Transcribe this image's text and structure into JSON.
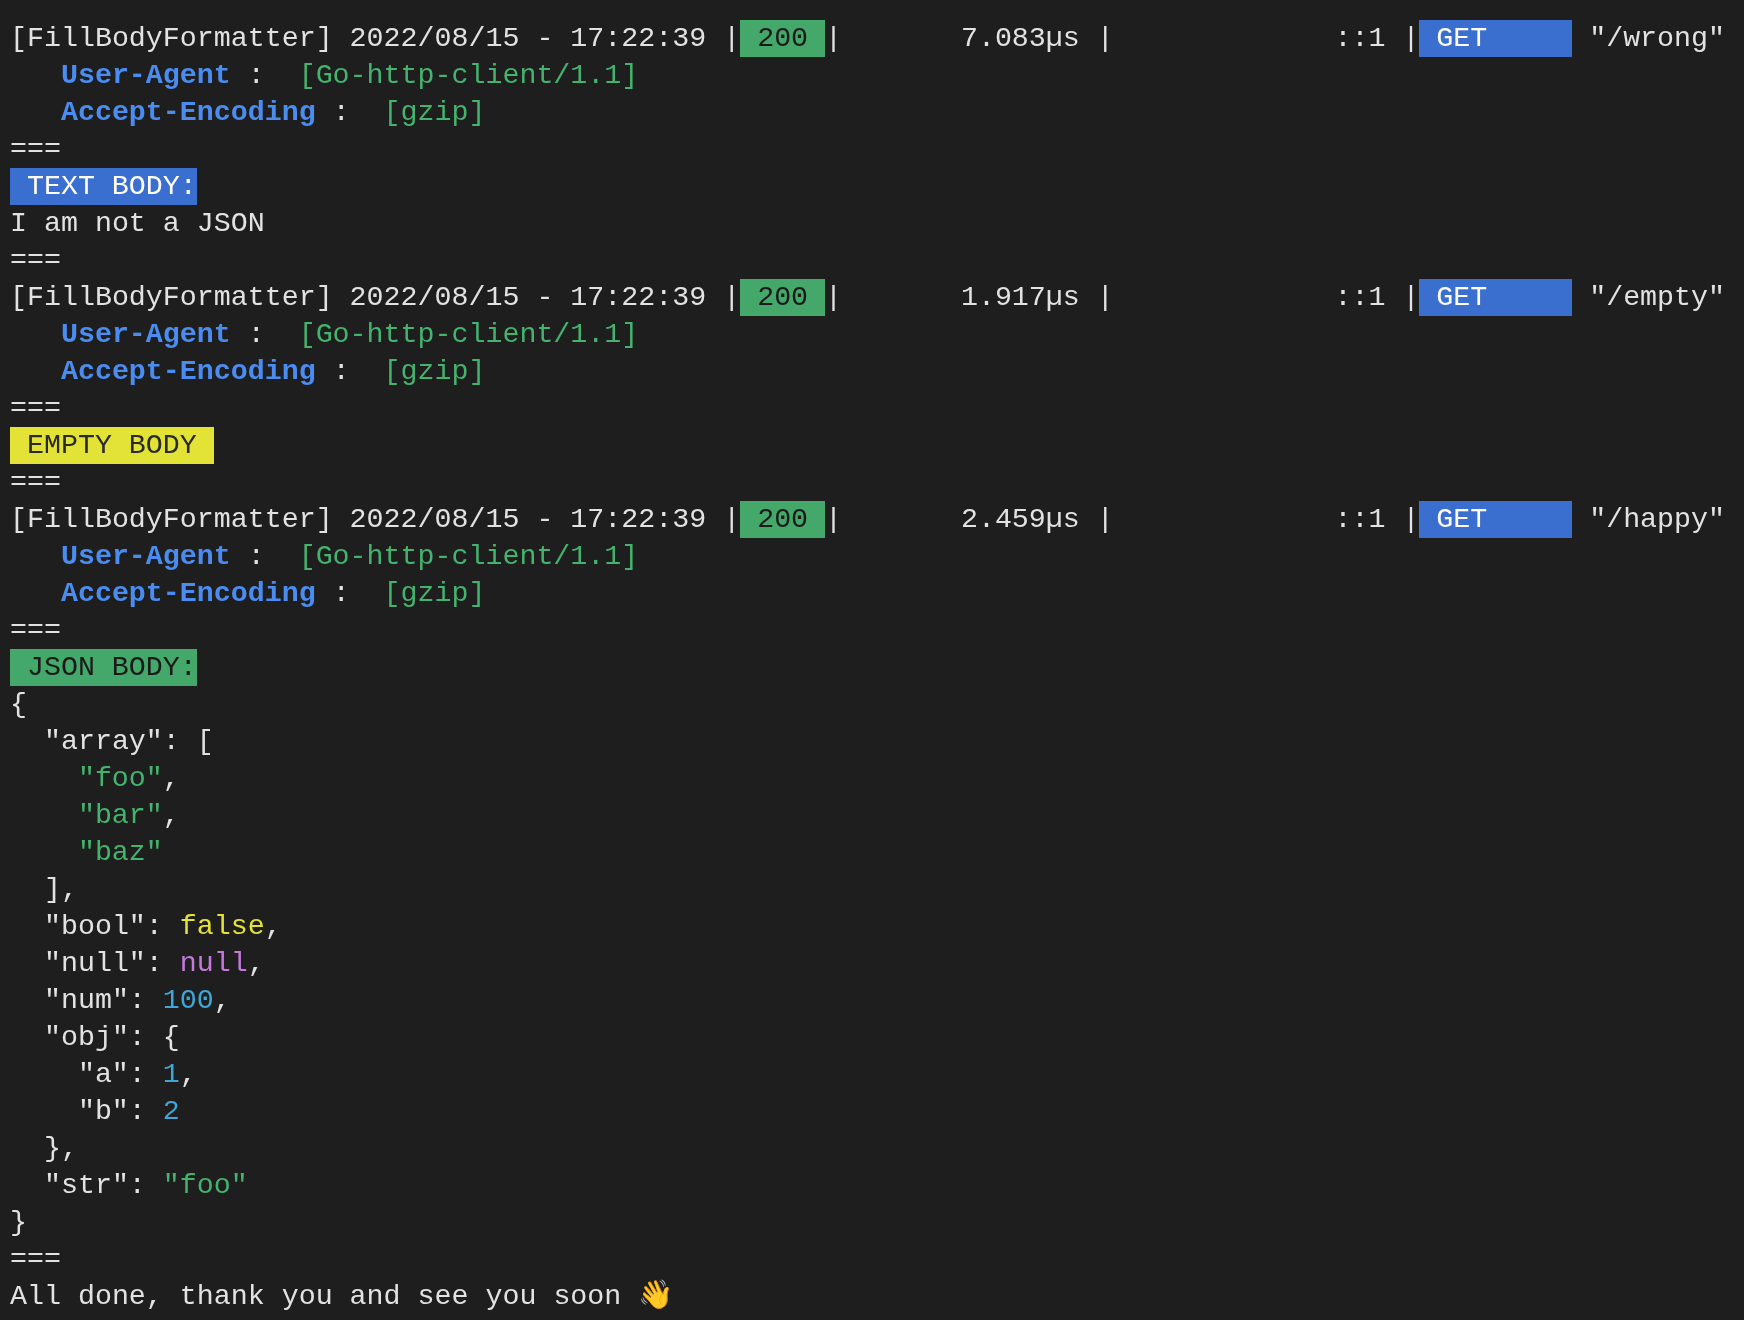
{
  "requests": [
    {
      "prefix": "[FillBodyFormatter] 2022/08/15 - 17:22:39 |",
      "status": "200",
      "status_end": "|",
      "latency": "7.083µs |",
      "client": "::1 |",
      "method": "GET",
      "path": "\"/wrong\"",
      "headers": [
        {
          "name": "User-Agent",
          "sep": ":",
          "value": "[Go-http-client/1.1]"
        },
        {
          "name": "Accept-Encoding",
          "sep": ":",
          "value": "[gzip]"
        }
      ],
      "separator_before": "===",
      "body": {
        "kind": "text",
        "label": "TEXT BODY:",
        "lines": [
          "I am not a JSON"
        ]
      },
      "separator_after": "==="
    },
    {
      "prefix": "[FillBodyFormatter] 2022/08/15 - 17:22:39 |",
      "status": "200",
      "status_end": "|",
      "latency": "1.917µs |",
      "client": "::1 |",
      "method": "GET",
      "path": "\"/empty\"",
      "headers": [
        {
          "name": "User-Agent",
          "sep": ":",
          "value": "[Go-http-client/1.1]"
        },
        {
          "name": "Accept-Encoding",
          "sep": ":",
          "value": "[gzip]"
        }
      ],
      "separator_before": "===",
      "body": {
        "kind": "empty",
        "label": "EMPTY BODY"
      },
      "separator_after": "==="
    },
    {
      "prefix": "[FillBodyFormatter] 2022/08/15 - 17:22:39 |",
      "status": "200",
      "status_end": "|",
      "latency": "2.459µs |",
      "client": "::1 |",
      "method": "GET",
      "path": "\"/happy\"",
      "headers": [
        {
          "name": "User-Agent",
          "sep": ":",
          "value": "[Go-http-client/1.1]"
        },
        {
          "name": "Accept-Encoding",
          "sep": ":",
          "value": "[gzip]"
        }
      ],
      "separator_before": "===",
      "body": {
        "kind": "json",
        "label": "JSON BODY:",
        "tree": {
          "tokens": [
            {
              "t": "{",
              "kind": "punct"
            }
          ],
          "children": [
            {
              "tokens": [
                {
                  "t": "\"array\":",
                  "kind": "key"
                },
                {
                  "t": "[",
                  "kind": "punct"
                }
              ],
              "children": [
                {
                  "tokens": [
                    {
                      "t": "\"foo\"",
                      "kind": "string"
                    },
                    {
                      "t": ",",
                      "kind": "punct"
                    }
                  ]
                },
                {
                  "tokens": [
                    {
                      "t": "\"bar\"",
                      "kind": "string"
                    },
                    {
                      "t": ",",
                      "kind": "punct"
                    }
                  ]
                },
                {
                  "tokens": [
                    {
                      "t": "\"baz\"",
                      "kind": "string"
                    }
                  ]
                }
              ],
              "close": [
                {
                  "t": "],",
                  "kind": "punct"
                }
              ]
            },
            {
              "tokens": [
                {
                  "t": "\"bool\":",
                  "kind": "key"
                },
                {
                  "t": "false",
                  "kind": "bool"
                },
                {
                  "t": ",",
                  "kind": "punct"
                }
              ]
            },
            {
              "tokens": [
                {
                  "t": "\"null\":",
                  "kind": "key"
                },
                {
                  "t": "null",
                  "kind": "null"
                },
                {
                  "t": ",",
                  "kind": "punct"
                }
              ]
            },
            {
              "tokens": [
                {
                  "t": "\"num\":",
                  "kind": "key"
                },
                {
                  "t": "100",
                  "kind": "number"
                },
                {
                  "t": ",",
                  "kind": "punct"
                }
              ]
            },
            {
              "tokens": [
                {
                  "t": "\"obj\":",
                  "kind": "key"
                },
                {
                  "t": "{",
                  "kind": "punct"
                }
              ],
              "children": [
                {
                  "tokens": [
                    {
                      "t": "\"a\":",
                      "kind": "key"
                    },
                    {
                      "t": "1",
                      "kind": "number"
                    },
                    {
                      "t": ",",
                      "kind": "punct"
                    }
                  ]
                },
                {
                  "tokens": [
                    {
                      "t": "\"b\":",
                      "kind": "key"
                    },
                    {
                      "t": "2",
                      "kind": "number"
                    }
                  ]
                }
              ],
              "close": [
                {
                  "t": "},",
                  "kind": "punct"
                }
              ]
            },
            {
              "tokens": [
                {
                  "t": "\"str\":",
                  "kind": "key"
                },
                {
                  "t": "\"foo\"",
                  "kind": "string"
                }
              ]
            }
          ],
          "close": [
            {
              "t": "}",
              "kind": "punct"
            }
          ]
        }
      },
      "separator_after": "==="
    }
  ],
  "farewell": "All done, thank you and see you soon 👋"
}
